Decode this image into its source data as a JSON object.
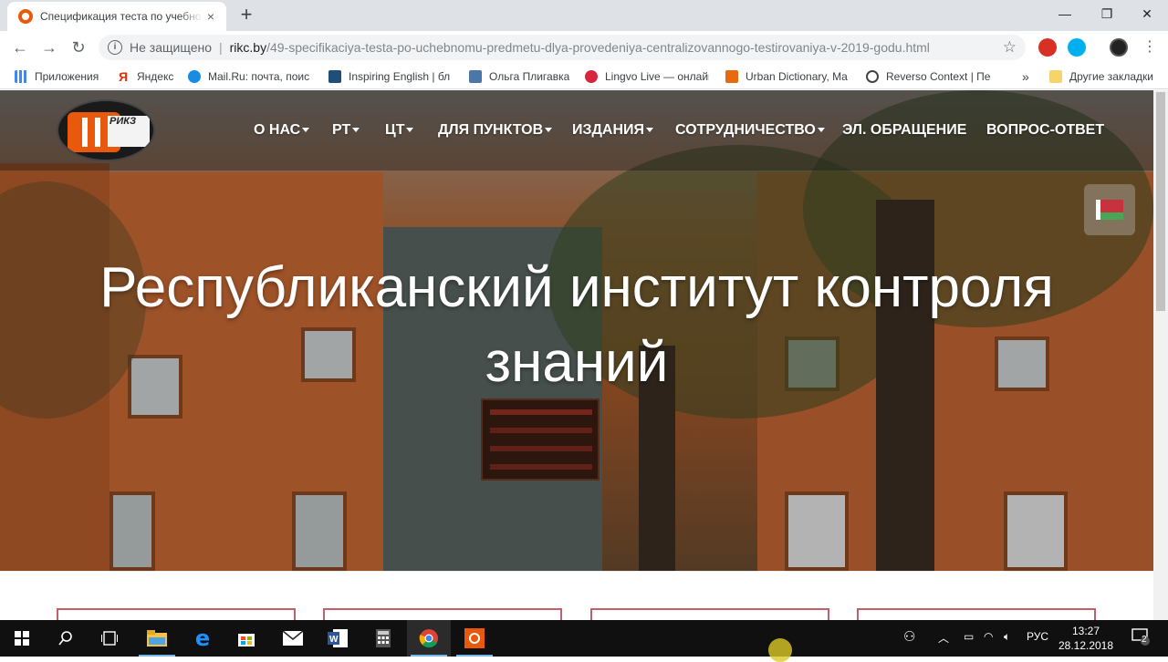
{
  "browser": {
    "tab_title": "Спецификация теста по учебно",
    "tab_close": "×",
    "new_tab": "+",
    "window": {
      "minimize": "—",
      "restore": "❐",
      "close": "✕"
    },
    "nav": {
      "back": "←",
      "forward": "→",
      "reload": "↻"
    },
    "omnibox": {
      "info_glyph": "i",
      "security_text": "Не защищено",
      "separator": "|",
      "host": "rikc.by",
      "path": "/49-specifikaciya-testa-po-uchebnomu-predmetu-dlya-provedeniya-centralizovannogo-testirovaniya-v-2019-godu.html",
      "star": "☆"
    },
    "bookmarks": [
      {
        "label": "Приложения",
        "icon": "apps-grid-icon",
        "color": "#4285f4"
      },
      {
        "label": "Яндекс",
        "icon": "yandex-icon",
        "color": "#e62e04"
      },
      {
        "label": "Mail.Ru: почта, поис",
        "icon": "mailru-icon",
        "color": "#168de2"
      },
      {
        "label": "Inspiring English | бл",
        "icon": "inspiring-english-icon",
        "color": "#1f4e79"
      },
      {
        "label": "Ольга Плигавка",
        "icon": "vk-icon",
        "color": "#4a76a8"
      },
      {
        "label": "Lingvo Live — онлайн",
        "icon": "lingvo-icon",
        "color": "#d7263d"
      },
      {
        "label": "Urban Dictionary, Ma",
        "icon": "urban-dictionary-icon",
        "color": "#e86a10"
      },
      {
        "label": "Reverso Context | Пе",
        "icon": "reverso-icon",
        "color": "#444"
      }
    ],
    "bookmarks_more": "»",
    "other_bookmarks": "Другие закладки"
  },
  "site": {
    "logo_text": "РИКЗ",
    "menu": [
      {
        "label": "О НАС",
        "dropdown": true
      },
      {
        "label": "РТ",
        "dropdown": true
      },
      {
        "label": "ЦТ",
        "dropdown": true
      },
      {
        "label": "ДЛЯ ПУНКТОВ",
        "dropdown": true
      },
      {
        "label": "ИЗДАНИЯ",
        "dropdown": true
      },
      {
        "label": "СОТРУДНИЧЕСТВО",
        "dropdown": true
      },
      {
        "label": "ЭЛ. ОБРАЩЕНИЕ",
        "dropdown": false
      },
      {
        "label": "ВОПРОС-ОТВЕТ",
        "dropdown": false
      }
    ],
    "headline_line1": "Республиканский институт контроля",
    "headline_line2": "знаний",
    "accent_color": "#e8590c"
  },
  "taskbar": {
    "apps": [
      "windows-start-icon",
      "search-icon",
      "task-view-icon",
      "file-explorer-icon",
      "edge-icon",
      "store-icon",
      "mail-icon",
      "word-icon",
      "calculator-icon",
      "chrome-icon",
      "screen-recorder-icon"
    ],
    "language": "РУС",
    "time": "13:27",
    "date": "28.12.2018",
    "notifications": "2"
  }
}
